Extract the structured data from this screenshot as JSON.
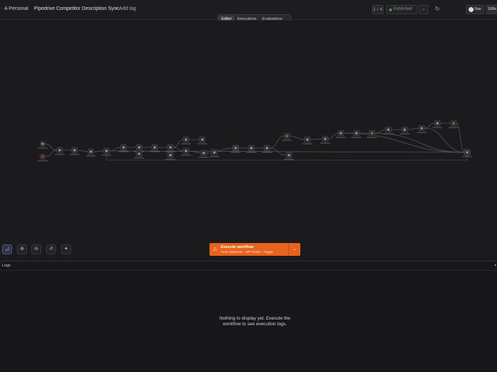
{
  "header": {
    "breadcrumb_project": "A Personal",
    "workflow_title": "Pipedrive Competitor Description Sync",
    "add_tag": "+ Add tag",
    "version_count": "1 / 4",
    "publish_status": "Published",
    "github_star_label": "Star",
    "github_star_count": "186k"
  },
  "tabs": [
    {
      "label": "Editor",
      "active": true
    },
    {
      "label": "Executions",
      "active": false
    },
    {
      "label": "Evaluations",
      "active": false
    }
  ],
  "canvas_controls": [
    {
      "name": "zoom-to-fit-button",
      "icon": "fit-view-icon"
    },
    {
      "name": "zoom-in-button",
      "icon": "zoom-in-icon"
    },
    {
      "name": "zoom-out-button",
      "icon": "zoom-out-icon"
    },
    {
      "name": "reset-zoom-button",
      "icon": "reset-icon"
    },
    {
      "name": "clean-up-button",
      "icon": "wand-icon"
    }
  ],
  "execute": {
    "label": "Execute workflow",
    "sublabel": "From Webhook - WP Plume - Trigger",
    "icon": "flask-icon"
  },
  "logs": {
    "title": "Logs",
    "empty_message": "Nothing to display yet. Execute the workflow to see execution logs."
  },
  "colors": {
    "accent": "#e8631d",
    "background": "#1b1b1d",
    "node_fill": "#2c2c30",
    "node_border": "#4a4a50",
    "published_dot": "#3d9b58"
  },
  "workflow_nodes": [
    "trigger-1",
    "trigger-2",
    "node-3",
    "node-4",
    "node-5",
    "node-6",
    "node-7",
    "node-8",
    "node-9",
    "node-10",
    "node-11",
    "node-12",
    "node-13",
    "node-14",
    "node-15",
    "node-16",
    "node-17",
    "node-18",
    "node-19",
    "node-20",
    "node-21",
    "node-22",
    "node-23",
    "node-24",
    "node-25",
    "node-26",
    "node-27",
    "node-28",
    "node-29",
    "node-30",
    "node-31",
    "node-32",
    "node-33"
  ]
}
